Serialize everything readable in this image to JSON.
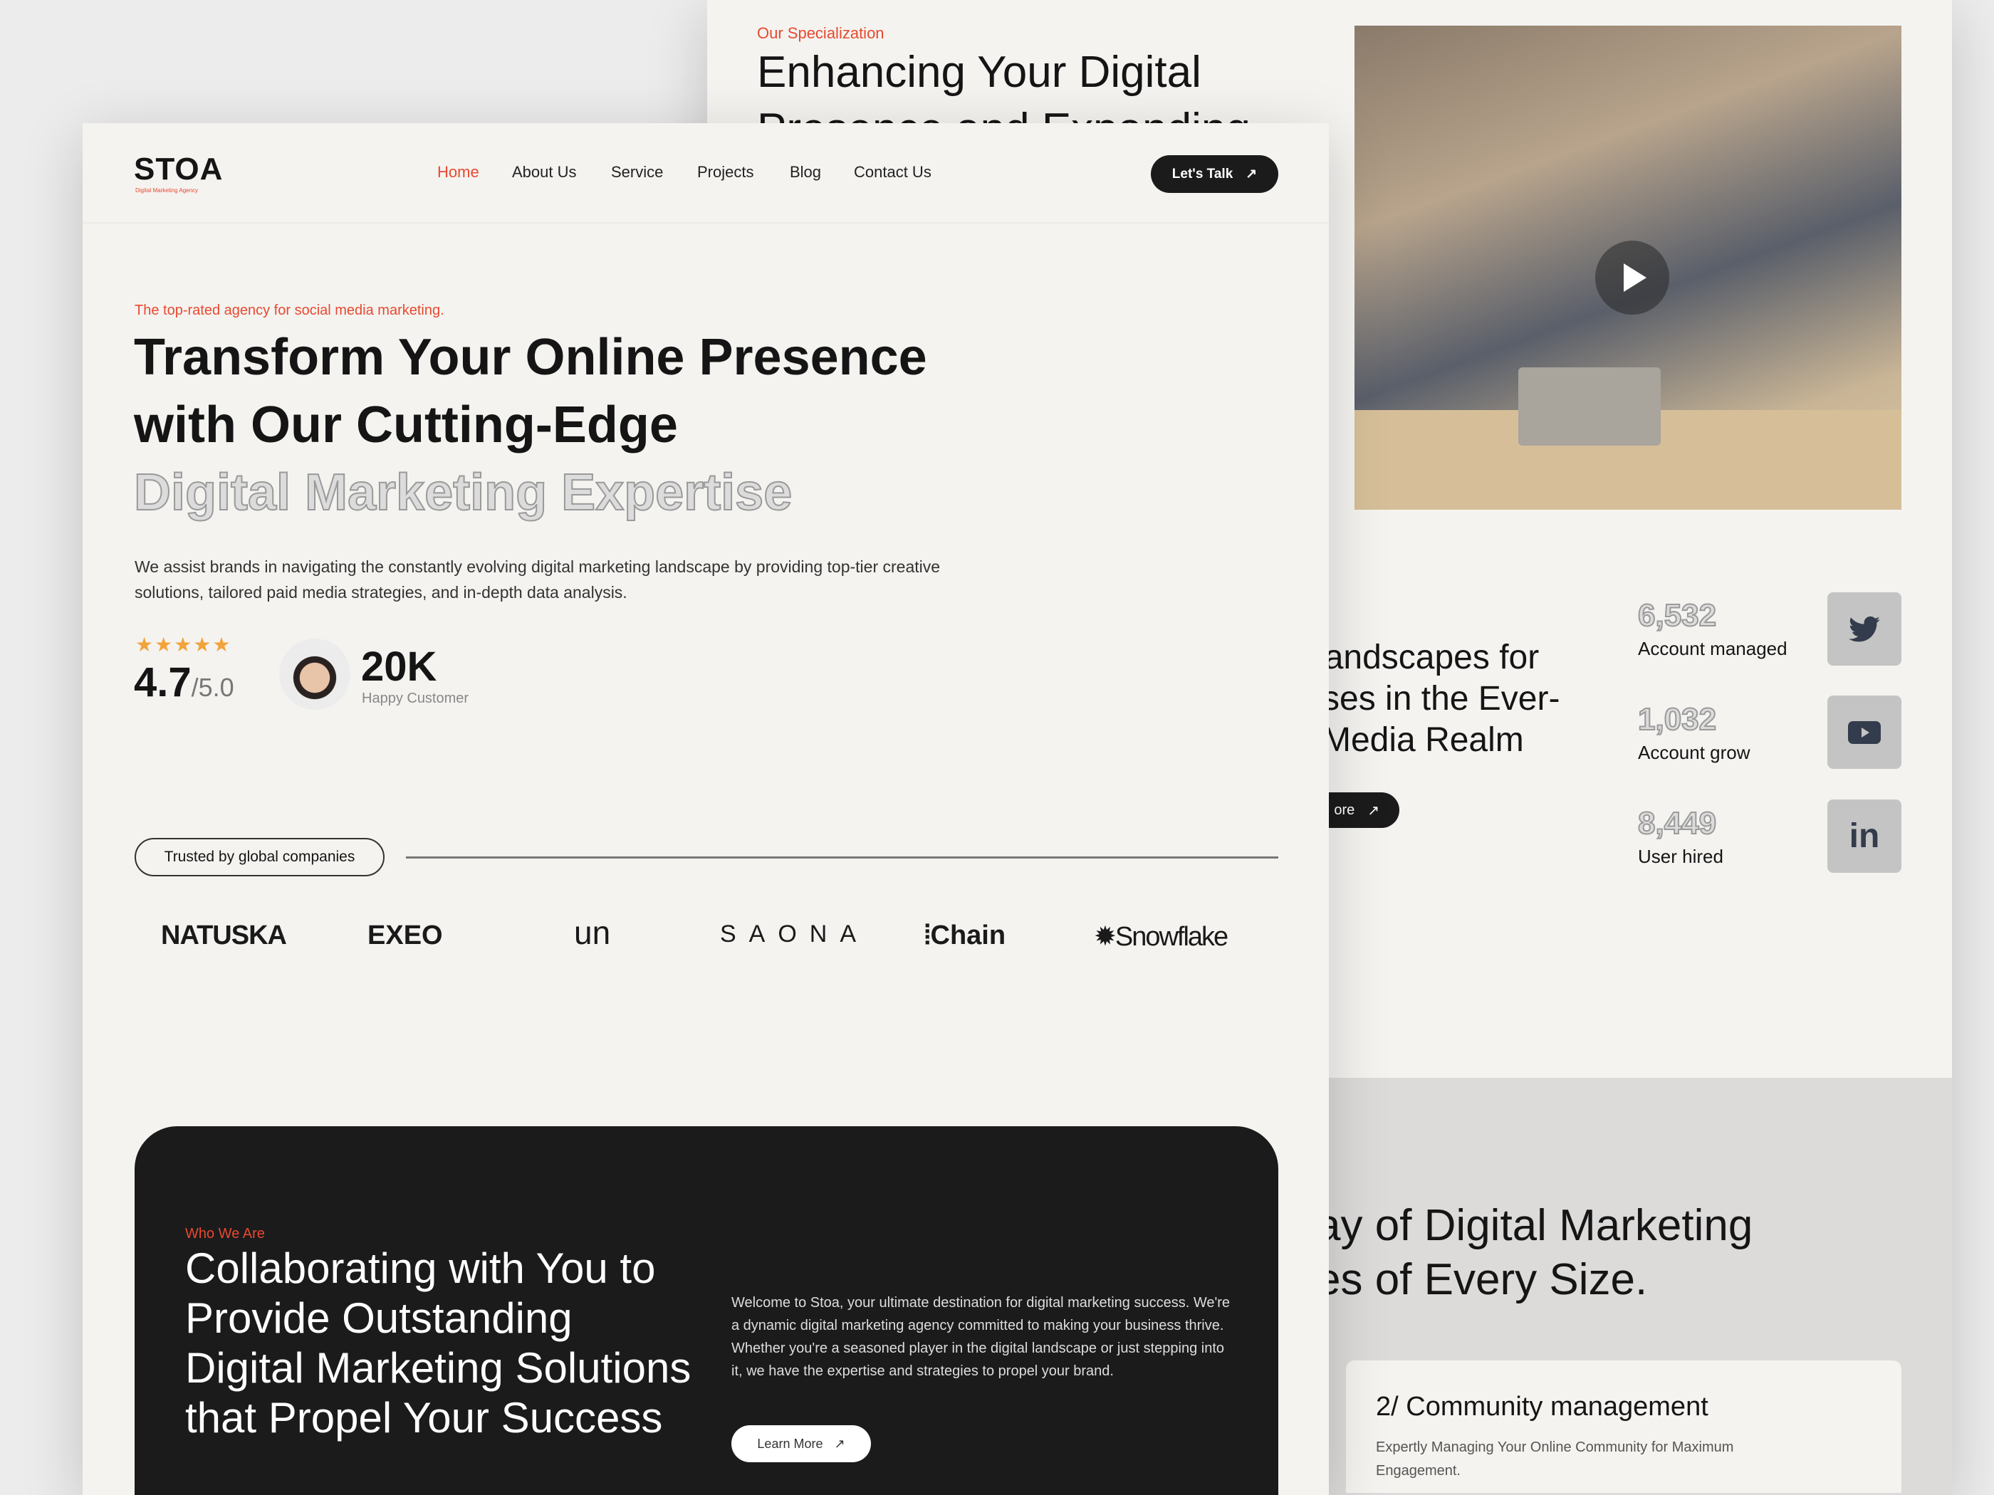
{
  "back": {
    "eyebrow": "Our Specialization",
    "heading_line1": "Enhancing Your Digital",
    "heading_line2": "Presence and Expanding",
    "partial_heading": [
      "Landscapes for",
      "sses in the Ever-",
      "l Media Realm"
    ],
    "partial_button": "ore",
    "stats": [
      {
        "value": "6,532",
        "label": "Account managed",
        "icon": "twitter-icon"
      },
      {
        "value": "1,032",
        "label": "Account grow",
        "icon": "youtube-icon"
      },
      {
        "value": "8,449",
        "label": "User hired",
        "icon": "linkedin-icon"
      }
    ],
    "services_heading": [
      "ay of Digital Marketing",
      "es of Every Size."
    ],
    "card": {
      "title": "2/ Community management",
      "description": "Expertly Managing Your Online Community for Maximum Engagement."
    }
  },
  "front": {
    "logo": "STOA",
    "logo_tagline": "Digital Marketing Agency",
    "nav": [
      "Home",
      "About Us",
      "Service",
      "Projects",
      "Blog",
      "Contact Us"
    ],
    "cta": "Let's Talk",
    "hero": {
      "eyebrow": "The top-rated agency for social media marketing.",
      "line1": "Transform Your Online Presence",
      "line2": "with Our Cutting-Edge",
      "line3": "Digital Marketing Expertise",
      "paragraph": "We assist brands in navigating the constantly evolving digital marketing landscape by providing top-tier creative solutions, tailored paid media strategies, and in-depth data analysis.",
      "rating": "4.7",
      "rating_max": "/5.0",
      "stars": 5,
      "customers": "20K",
      "customers_label": "Happy Customer"
    },
    "trusted_label": "Trusted by global companies",
    "logos": [
      "NATUSKA",
      "EXEO",
      "un",
      "SAONA",
      "Chain",
      "Snowflake"
    ],
    "about": {
      "eyebrow": "Who We Are",
      "heading": "Collaborating with You to Provide Outstanding Digital Marketing Solutions that Propel Your Success",
      "paragraph": "Welcome to Stoa, your ultimate destination for digital marketing success. We're a dynamic digital marketing agency committed to making your business thrive. Whether you're a seasoned player in the digital landscape or just stepping into it, we have the expertise and strategies to propel your brand.",
      "button": "Learn More"
    }
  },
  "colors": {
    "accent": "#e8492f",
    "dark": "#1b1b1b",
    "star": "#f2a33a",
    "background": "#f4f3f0"
  }
}
